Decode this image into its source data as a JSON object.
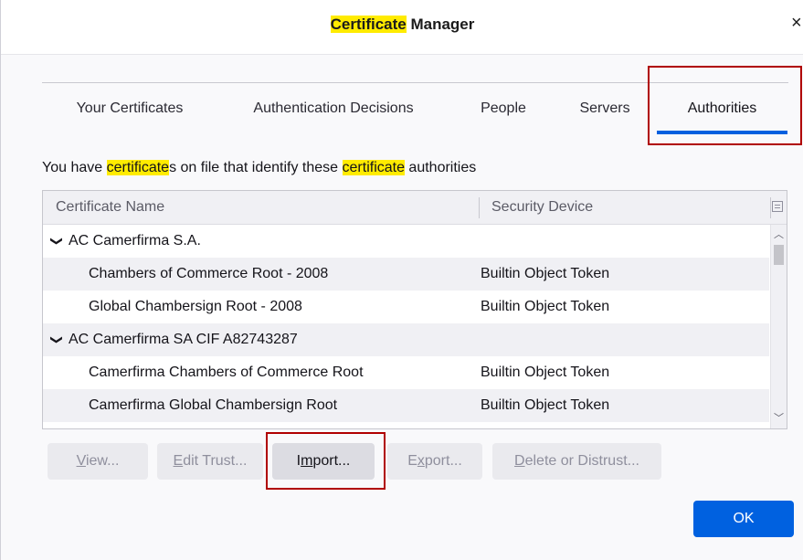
{
  "window": {
    "title_highlight": "Certificate",
    "title_rest": " Manager",
    "close_glyph": "×"
  },
  "tabs": [
    {
      "label": "Your Certificates",
      "active": false
    },
    {
      "label": "Authentication Decisions",
      "active": false
    },
    {
      "label": "People",
      "active": false
    },
    {
      "label": "Servers",
      "active": false
    },
    {
      "label": "Authorities",
      "active": true
    }
  ],
  "description": {
    "p1": "You have ",
    "h1": "certificate",
    "p2": "s on file that identify these ",
    "h2": "certificate",
    "p3": " authorities"
  },
  "table": {
    "columns": [
      "Certificate Name",
      "Security Device"
    ],
    "rows": [
      {
        "type": "group",
        "expanded": true,
        "name": "AC Camerfirma S.A.",
        "device": ""
      },
      {
        "type": "child",
        "name": "Chambers of Commerce Root - 2008",
        "device": "Builtin Object Token"
      },
      {
        "type": "child",
        "name": "Global Chambersign Root - 2008",
        "device": "Builtin Object Token"
      },
      {
        "type": "group",
        "expanded": true,
        "name": "AC Camerfirma SA CIF A82743287",
        "device": ""
      },
      {
        "type": "child",
        "name": "Camerfirma Chambers of Commerce Root",
        "device": "Builtin Object Token"
      },
      {
        "type": "child",
        "name": "Camerfirma Global Chambersign Root",
        "device": "Builtin Object Token"
      }
    ]
  },
  "buttons": {
    "view": {
      "mnemonic": "V",
      "rest": "iew..."
    },
    "edit_trust": {
      "mnemonic": "E",
      "rest": "dit Trust..."
    },
    "import": {
      "pre": "I",
      "mnemonic": "m",
      "rest": "port..."
    },
    "export": {
      "pre": "E",
      "mnemonic": "x",
      "rest": "port..."
    },
    "delete": {
      "mnemonic": "D",
      "rest": "elete or Distrust..."
    },
    "ok": "OK"
  },
  "colors": {
    "highlight": "#ffeb00",
    "accent": "#0060df",
    "annotation_box": "#b00000"
  }
}
